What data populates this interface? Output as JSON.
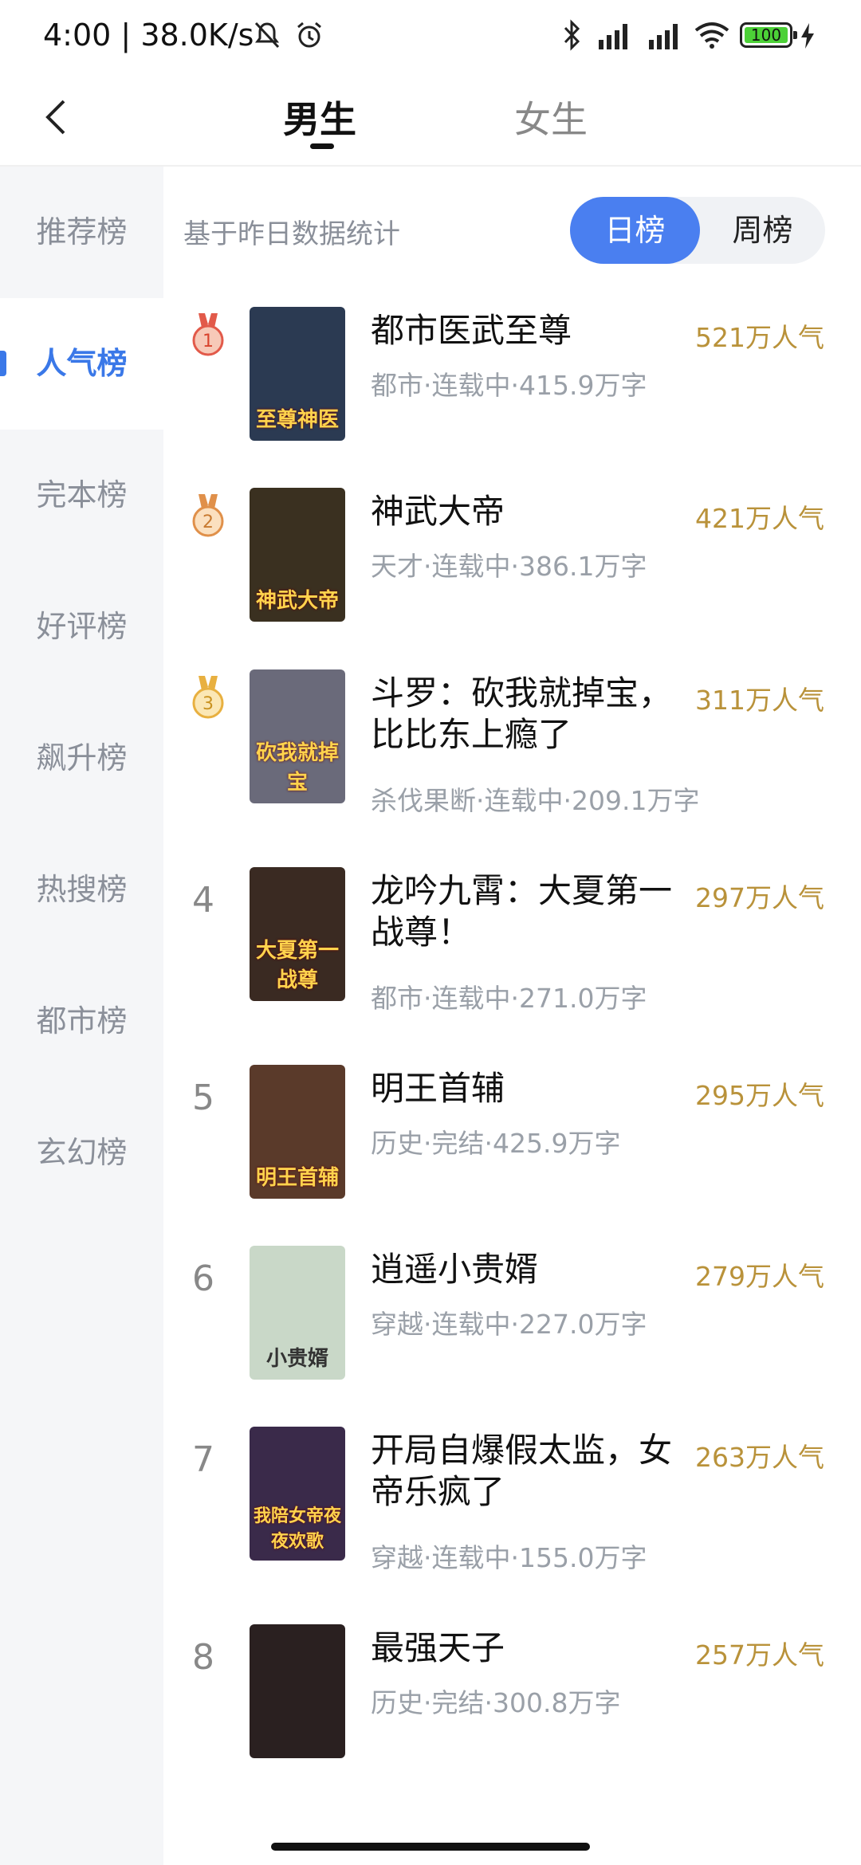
{
  "status_bar": {
    "time": "4:00",
    "speed": "38.0K/s",
    "battery": "100"
  },
  "header": {
    "tabs": [
      "男生",
      "女生"
    ],
    "active_tab": "男生"
  },
  "sidebar": {
    "items": [
      "推荐榜",
      "人气榜",
      "完本榜",
      "好评榜",
      "飙升榜",
      "热搜榜",
      "都市榜",
      "玄幻榜"
    ],
    "active_index": 1
  },
  "main": {
    "subtitle": "基于昨日数据统计",
    "segments": [
      "日榜",
      "周榜"
    ],
    "active_segment": "日榜"
  },
  "books": [
    {
      "rank": "1",
      "title": "都市医武至尊",
      "meta": "都市·连载中·415.9万字",
      "popularity": "521万人气",
      "cover_text": "至尊神医",
      "cover_color": "#2b3a52"
    },
    {
      "rank": "2",
      "title": "神武大帝",
      "meta": "天才·连载中·386.1万字",
      "popularity": "421万人气",
      "cover_text": "神武大帝",
      "cover_color": "#3a3020"
    },
    {
      "rank": "3",
      "title": "斗罗：砍我就掉宝，比比东上瘾了",
      "meta": "杀伐果断·连载中·209.1万字",
      "popularity": "311万人气",
      "cover_text": "砍我就掉宝",
      "cover_color": "#6a6a7a"
    },
    {
      "rank": "4",
      "title": "龙吟九霄：大夏第一战尊！",
      "meta": "都市·连载中·271.0万字",
      "popularity": "297万人气",
      "cover_text": "大夏第一战尊",
      "cover_color": "#3a2a22"
    },
    {
      "rank": "5",
      "title": "明王首辅",
      "meta": "历史·完结·425.9万字",
      "popularity": "295万人气",
      "cover_text": "明王首辅",
      "cover_color": "#5a3a2a"
    },
    {
      "rank": "6",
      "title": "逍遥小贵婿",
      "meta": "穿越·连载中·227.0万字",
      "popularity": "279万人气",
      "cover_text": "小贵婿",
      "cover_color": "#c9d8c8"
    },
    {
      "rank": "7",
      "title": "开局自爆假太监，女帝乐疯了",
      "meta": "穿越·连载中·155.0万字",
      "popularity": "263万人气",
      "cover_text": "我陪女帝夜夜欢歌",
      "cover_color": "#3a2a4a"
    },
    {
      "rank": "8",
      "title": "最强天子",
      "meta": "历史·完结·300.8万字",
      "popularity": "257万人气",
      "cover_text": "",
      "cover_color": "#2a2020"
    }
  ]
}
